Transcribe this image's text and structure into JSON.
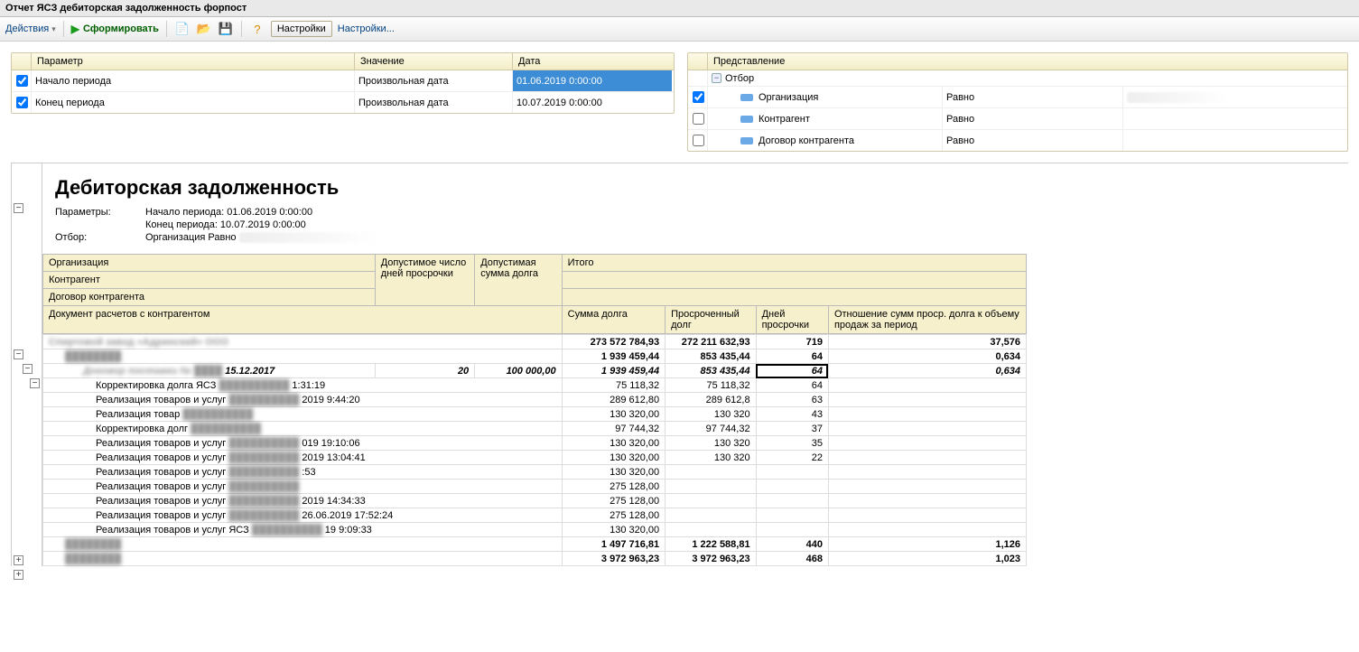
{
  "titlebar": "Отчет  ЯСЗ дебиторская задолженность форпост",
  "toolbar": {
    "actions": "Действия",
    "generate": "Сформировать",
    "settings_btn": "Настройки",
    "settings_link": "Настройки..."
  },
  "params_grid": {
    "headers": {
      "param": "Параметр",
      "value": "Значение",
      "date": "Дата"
    },
    "rows": [
      {
        "checked": true,
        "param": "Начало периода",
        "value": "Произвольная дата",
        "date": "01.06.2019 0:00:00",
        "selected": true
      },
      {
        "checked": true,
        "param": "Конец периода",
        "value": "Произвольная дата",
        "date": "10.07.2019 0:00:00",
        "selected": false
      }
    ]
  },
  "filter_grid": {
    "header": "Представление",
    "root": "Отбор",
    "col_op": "Равно",
    "rows": [
      {
        "checked": true,
        "name": "Организация",
        "op": "Равно",
        "value_hidden": true
      },
      {
        "checked": false,
        "name": "Контрагент",
        "op": "Равно",
        "value_hidden": false
      },
      {
        "checked": false,
        "name": "Договор контрагента",
        "op": "Равно",
        "value_hidden": false
      }
    ]
  },
  "report": {
    "title": "Дебиторская задолженность",
    "params_label": "Параметры:",
    "filter_label": "Отбор:",
    "param_lines": [
      "Начало периода: 01.06.2019 0:00:00",
      "Конец периода: 10.07.2019 0:00:00"
    ],
    "filter_line_prefix": "Организация Равно",
    "header": {
      "organization": "Организация",
      "counterparty": "Контрагент",
      "contract": "Договор контрагента",
      "allowed_days": "Допустимое число дней просрочки",
      "allowed_sum": "Допустимая сумма долга",
      "total": "Итого",
      "doc": "Документ расчетов с контрагентом",
      "sum": "Сумма долга",
      "overdue": "Просроченный долг",
      "days": "Дней просрочки",
      "ratio": "Отношение сумм проср. долга к объему продаж за период"
    },
    "rows": [
      {
        "level": 0,
        "kind": "total",
        "name_masked": "Спиртовой завод «Адринский» ООО",
        "days_allowed": "",
        "amount_allowed": "",
        "sum": "273 572 784,93",
        "overdue": "272 211 632,93",
        "days": "719",
        "ratio": "37,576"
      },
      {
        "level": 1,
        "kind": "subtotal",
        "name_masked": "",
        "days_allowed": "",
        "amount_allowed": "",
        "sum": "1 939 459,44",
        "overdue": "853 435,44",
        "days": "64",
        "ratio": "0,634"
      },
      {
        "level": 2,
        "kind": "contract",
        "name_prefix": "Договор поставки №",
        "name_suffix": "15.12.2017",
        "days_allowed": "20",
        "amount_allowed": "100 000,00",
        "sum": "1 939 459,44",
        "overdue": "853 435,44",
        "days": "64",
        "ratio": "0,634",
        "focus": true
      },
      {
        "level": 3,
        "kind": "doc",
        "name": "Корректировка долга ЯСЗ",
        "tail": "1:31:19",
        "sum": "75 118,32",
        "overdue": "75 118,32",
        "days": "64",
        "ratio": ""
      },
      {
        "level": 3,
        "kind": "doc",
        "name": "Реализация товаров и услуг",
        "tail": "2019 9:44:20",
        "sum": "289 612,80",
        "overdue": "289 612,8",
        "days": "63",
        "ratio": ""
      },
      {
        "level": 3,
        "kind": "doc",
        "name": "Реализация товар",
        "tail": "",
        "sum": "130 320,00",
        "overdue": "130 320",
        "days": "43",
        "ratio": ""
      },
      {
        "level": 3,
        "kind": "doc",
        "name": "Корректировка долг",
        "tail": "",
        "sum": "97 744,32",
        "overdue": "97 744,32",
        "days": "37",
        "ratio": ""
      },
      {
        "level": 3,
        "kind": "doc",
        "name": "Реализация товаров и услуг",
        "tail": "019 19:10:06",
        "sum": "130 320,00",
        "overdue": "130 320",
        "days": "35",
        "ratio": ""
      },
      {
        "level": 3,
        "kind": "doc",
        "name": "Реализация товаров и услуг",
        "tail": "2019 13:04:41",
        "sum": "130 320,00",
        "overdue": "130 320",
        "days": "22",
        "ratio": ""
      },
      {
        "level": 3,
        "kind": "doc",
        "name": "Реализация товаров и услуг",
        "tail": ":53",
        "sum": "130 320,00",
        "overdue": "",
        "days": "",
        "ratio": ""
      },
      {
        "level": 3,
        "kind": "doc",
        "name": "Реализация товаров и услуг",
        "tail": "",
        "sum": "275 128,00",
        "overdue": "",
        "days": "",
        "ratio": ""
      },
      {
        "level": 3,
        "kind": "doc",
        "name": "Реализация товаров и услуг",
        "tail": "2019 14:34:33",
        "sum": "275 128,00",
        "overdue": "",
        "days": "",
        "ratio": ""
      },
      {
        "level": 3,
        "kind": "doc",
        "name": "Реализация товаров и услуг",
        "tail": "26.06.2019 17:52:24",
        "sum": "275 128,00",
        "overdue": "",
        "days": "",
        "ratio": ""
      },
      {
        "level": 3,
        "kind": "doc",
        "name": "Реализация товаров и услуг ЯСЗ",
        "tail": "19 9:09:33",
        "sum": "130 320,00",
        "overdue": "",
        "days": "",
        "ratio": ""
      },
      {
        "level": 1,
        "kind": "subtotal_collapsed",
        "name_masked": "",
        "sum": "1 497 716,81",
        "overdue": "1 222 588,81",
        "days": "440",
        "ratio": "1,126"
      },
      {
        "level": 1,
        "kind": "subtotal_collapsed",
        "name_masked": "",
        "sum": "3 972 963,23",
        "overdue": "3 972 963,23",
        "days": "468",
        "ratio": "1,023"
      }
    ]
  }
}
